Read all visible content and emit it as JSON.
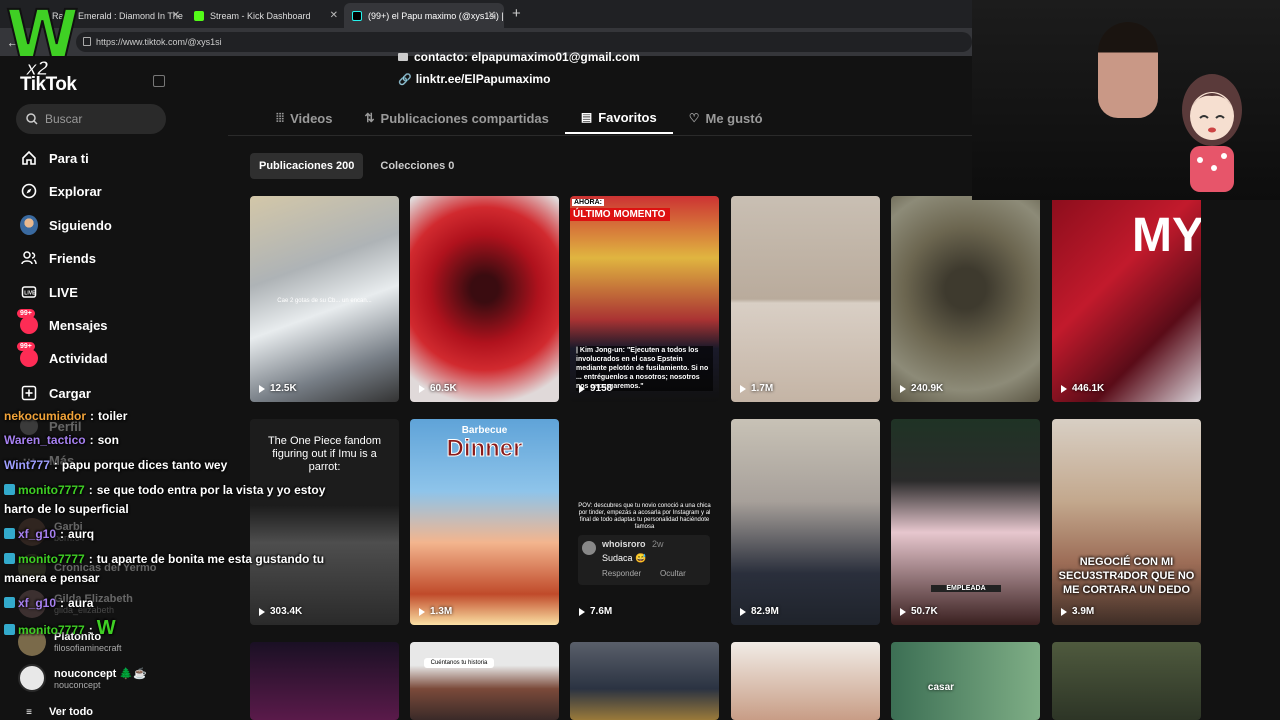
{
  "browser": {
    "tabs": [
      {
        "label": "Radio Emerald : Diamond In The",
        "active": false
      },
      {
        "label": "Stream - Kick Dashboard",
        "active": false
      },
      {
        "label": "(99+) el Papu maximo (@xys1si) | T",
        "active": true
      }
    ],
    "url": "https://www.tiktok.com/@xys1si"
  },
  "overlay": {
    "logo_letter": "W",
    "multiplier": "x2"
  },
  "sidebar": {
    "logo": "TikTok",
    "search_placeholder": "Buscar",
    "nav": [
      {
        "label": "Para ti",
        "icon": "home-icon"
      },
      {
        "label": "Explorar",
        "icon": "compass-icon"
      },
      {
        "label": "Siguiendo",
        "icon": "following-avatar-icon"
      },
      {
        "label": "Friends",
        "icon": "friends-icon"
      },
      {
        "label": "LIVE",
        "icon": "live-icon"
      },
      {
        "label": "Mensajes",
        "icon": "messages-icon",
        "badge": "99+"
      },
      {
        "label": "Actividad",
        "icon": "activity-icon",
        "badge": "99+"
      },
      {
        "label": "Cargar",
        "icon": "upload-icon"
      },
      {
        "label": "Perfil",
        "icon": "profile-icon"
      },
      {
        "label": "Más",
        "icon": "more-icon"
      }
    ],
    "following": [
      {
        "name": "Garbi",
        "handle": "born.64"
      },
      {
        "name": "Cronicas del Yermo",
        "handle": ""
      },
      {
        "name": "Gilda Elizabeth",
        "handle": "gilda_elizabeth"
      },
      {
        "name": "Platonito",
        "handle": "filosofiaminecraft"
      },
      {
        "name": "nouconcept 🌲☕",
        "handle": "nouconcept"
      }
    ],
    "see_all": "Ver todo"
  },
  "chat": [
    {
      "user": "nekocumiador",
      "sep": ":",
      "text": "toiler",
      "color": "#f1a339",
      "icon": false
    },
    {
      "user": "Waren_tactico",
      "sep": ":",
      "text": "son",
      "color": "#a680f0",
      "icon": false
    },
    {
      "user": "Wint777",
      "sep": ":",
      "text": "papu porque dices tanto wey",
      "color": "#9e9eff",
      "icon": false
    },
    {
      "user": "monito7777",
      "sep": ":",
      "text": "se que todo entra por la vista y yo estoy",
      "color": "#3fd024",
      "icon": true
    },
    {
      "user": "",
      "sep": "",
      "text": "harto de lo superficial",
      "color": "#ffffff",
      "icon": false
    },
    {
      "user": "xf_g10",
      "sep": ":",
      "text": "aurq",
      "color": "#a680f0",
      "icon": true
    },
    {
      "user": "monito7777",
      "sep": ":",
      "text": "tu aparte de bonita me esta gustando tu",
      "color": "#3fd024",
      "icon": true
    },
    {
      "user": "",
      "sep": "",
      "text": "manera e pensar",
      "color": "#ffffff",
      "icon": false
    },
    {
      "user": "xf_g10",
      "sep": ":",
      "text": "aura",
      "color": "#a680f0",
      "icon": true
    },
    {
      "user": "monito7777",
      "sep": ":",
      "text": "W",
      "color": "#3fd024",
      "icon": true
    }
  ],
  "profile": {
    "contact": "contacto: elpapumaximo01@gmail.com",
    "link": "linktr.ee/ElPapumaximo"
  },
  "tabs": [
    {
      "label": "Videos",
      "icon": "grid-icon",
      "active": false
    },
    {
      "label": "Publicaciones compartidas",
      "icon": "repost-icon",
      "active": false
    },
    {
      "label": "Favoritos",
      "icon": "bookmark-icon",
      "active": true
    },
    {
      "label": "Me gustó",
      "icon": "heart-icon",
      "active": false
    }
  ],
  "chips": [
    {
      "label": "Publicaciones 200",
      "active": true
    },
    {
      "label": "Colecciones 0",
      "active": false
    }
  ],
  "videos": [
    {
      "views": "12.5K",
      "caption": "Cae 2 gotas de su Cb... un encan...",
      "bg": "linear-gradient(160deg,#d3c7a8 0%,#aeb3b6 35%,#e8ecee 55%,#777e86 80%,#333 100%)"
    },
    {
      "views": "60.5K",
      "caption": "",
      "bg": "radial-gradient(circle at 50% 45%,#3a0c10 10%,#b0121d 40%,#d12a2f 60%,#e0d9d9 85%)"
    },
    {
      "views": "9158",
      "caption": "| Kim Jong-un: \"Ejecuten a todos los involucrados en el caso Epstein mediante pelotón de fusilamiento. Si no ... entréguenlos a nosotros; nosotros nos encargaremos.\"",
      "header": "ÚLTIMO MOMENTO",
      "tag": "AHORA:",
      "bg": "linear-gradient(180deg,#c33 0%,#e0b540 30%,#a33 60%,#1a1a2a 74%,#111 100%)"
    },
    {
      "views": "1.7M",
      "caption": "",
      "bg": "linear-gradient(180deg,#c9bfb3 0%,#b9ab9c 50%,#d9cfc5 52%,#c4b4a5 100%)"
    },
    {
      "views": "240.9K",
      "caption": "",
      "bg": "radial-gradient(circle at 50% 45%,#3e3a2e 15%,#6c6650 45%,#8d8b78 75%,#5b5644 100%)"
    },
    {
      "views": "446.1K",
      "caption": "MY",
      "bg": "linear-gradient(135deg,#8b0d1c 0%,#c21a2c 40%,#5a0c18 70%,#d8d2d8 100%)"
    },
    {
      "views": "303.4K",
      "caption": "The One Piece fandom figuring out if Imu is a parrot:",
      "bg": "linear-gradient(180deg,#1c1c1c 0%,#1c1c1c 42%,#4e4e4e 60%,#2a2a2a 100%)"
    },
    {
      "views": "1.3M",
      "caption": "Dinner",
      "header": "Barbecue",
      "bg": "linear-gradient(180deg,#5fa3d8 0%,#8ec4ea 35%,#f3b58e 60%,#c04a2a 85%,#fbe0a4 100%)"
    },
    {
      "views": "7.6M",
      "caption": "POV: descubres que tu novio conoció a una chica por tinder, empezás a acosarla por Instagram y al final de todo adaptas tu personalidad haciéndote famosa",
      "comment_user": "whoisroro",
      "comment_time": "2w",
      "comment_text": "Sudaca 😅",
      "reply": "Responder",
      "hide": "Ocultar",
      "bg": "#121212"
    },
    {
      "views": "82.9M",
      "caption": "",
      "bg": "linear-gradient(180deg,#c8c2b6 0%,#a7a09a 40%,#2a2f3c 75%,#1f232b 100%)"
    },
    {
      "views": "50.7K",
      "caption": "EMPLEADA",
      "bg": "linear-gradient(180deg,#1f3325 0%,#2b2b2b 30%,#e7c7ce 55%,#3a2020 100%)"
    },
    {
      "views": "3.9M",
      "caption": "NEGOCIÉ CON MI SECU3STR4DOR QUE NO ME CORTARA UN DEDO",
      "bg": "linear-gradient(180deg,#d8cfc4 0%,#c3a88d 40%,#9c6c56 70%,#3f2e26 100%)"
    },
    {
      "views": "",
      "caption": "",
      "bg": "linear-gradient(180deg,#1a1024,#5a1a4a)"
    },
    {
      "views": "",
      "caption": "Cuéntanos tu historia",
      "bg": "linear-gradient(180deg,#e8e8e8 0%,#e8e8e8 30%,#7b4a3a 60%,#3a2a28 100%)"
    },
    {
      "views": "",
      "caption": "",
      "bg": "linear-gradient(180deg,#5a5f6a,#2b3342 60%,#9a7a3a)"
    },
    {
      "views": "",
      "caption": "",
      "bg": "linear-gradient(180deg,#f1ece6,#c89d86)"
    },
    {
      "views": "",
      "caption": "casar",
      "bg": "linear-gradient(90deg,#3c6f54,#7fae86)"
    },
    {
      "views": "",
      "caption": "",
      "bg": "linear-gradient(180deg,#4f5a3e,#2d3526)"
    }
  ]
}
